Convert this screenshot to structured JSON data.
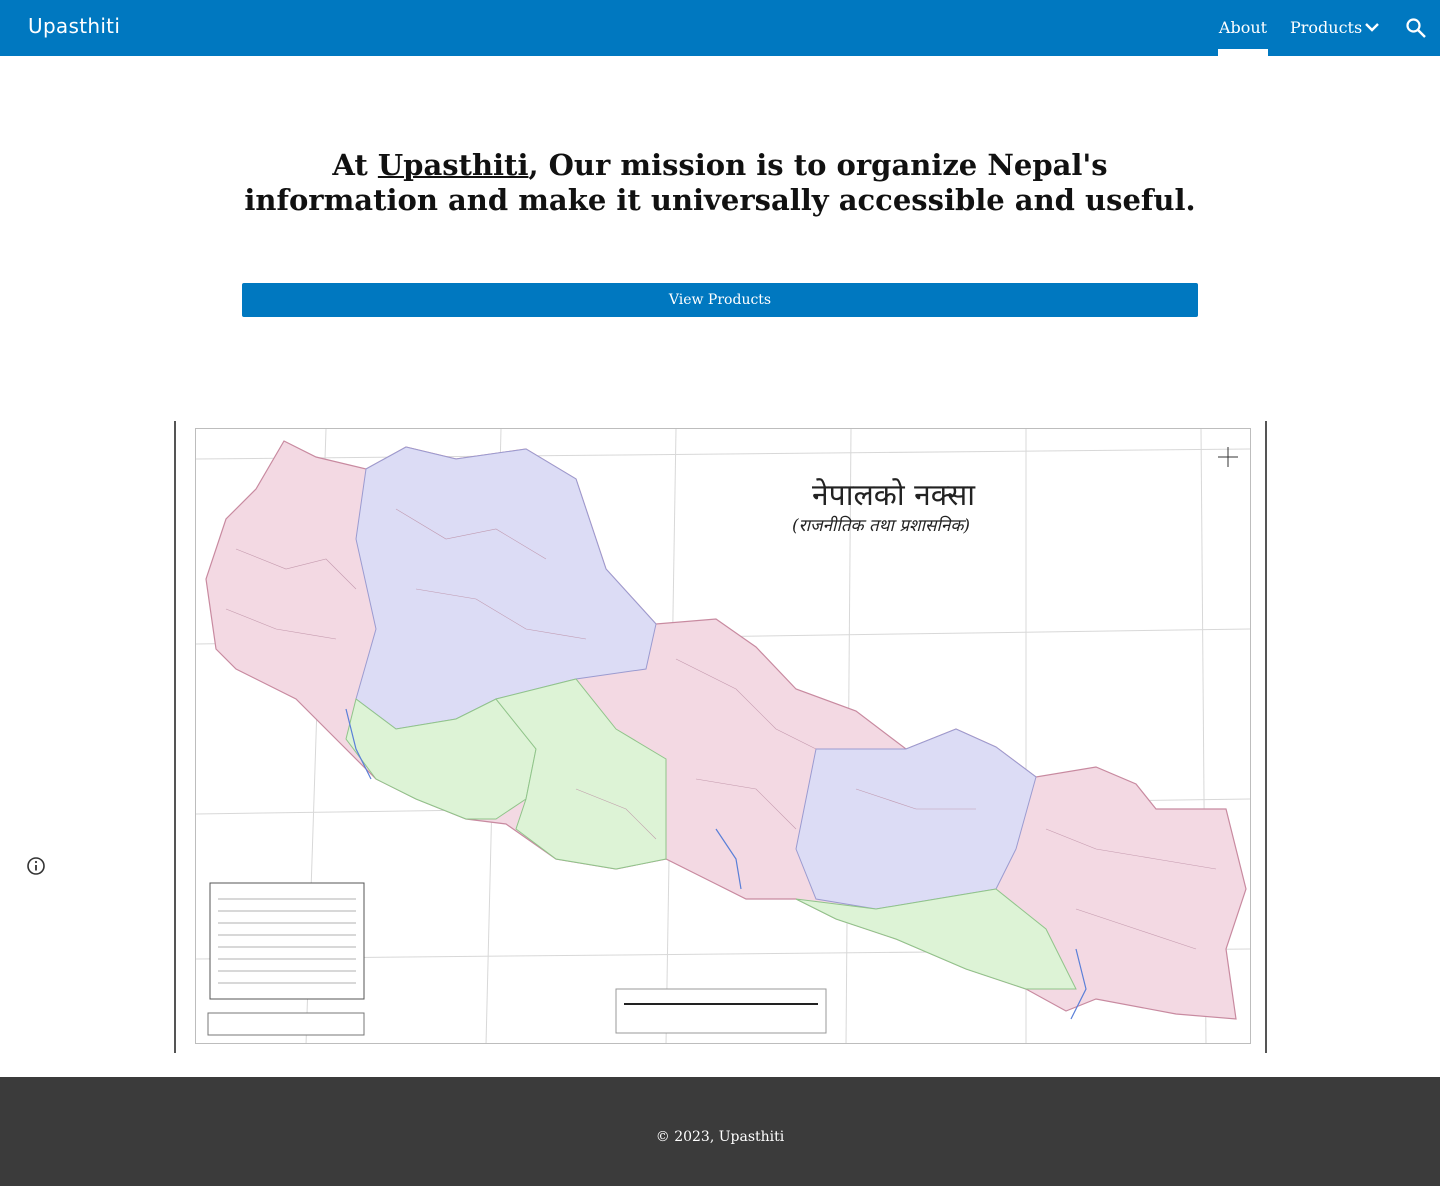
{
  "header": {
    "site_title": "Upasthiti",
    "nav": {
      "about": "About",
      "products": "Products"
    },
    "icons": {
      "chevron": "chevron-down-icon",
      "search": "search-icon"
    },
    "accent_color": "#0078c0"
  },
  "hero": {
    "headline_prefix": "At ",
    "headline_link": "Upasthiti",
    "headline_rest": ", Our mission is to organize Nepal's information and make it universally accessible and useful.",
    "cta_label": "View Products"
  },
  "map": {
    "title": "नेपालको नक्सा",
    "subtitle": "(राजनीतिक तथा प्रशासनिक)",
    "region_colors": [
      "#f3d9e3",
      "#dcdcf5",
      "#ddf3d6"
    ]
  },
  "footer": {
    "copyright": "© 2023, Upasthiti",
    "background": "#3b3b3b"
  },
  "side": {
    "info_icon": "info-icon"
  }
}
